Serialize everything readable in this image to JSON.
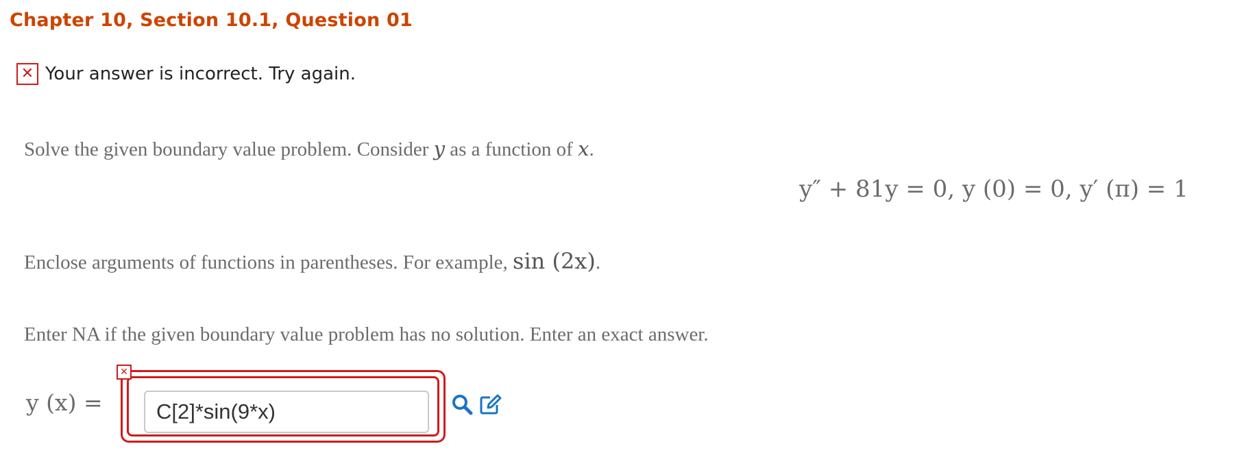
{
  "header": {
    "title": "Chapter 10, Section 10.1, Question 01"
  },
  "feedback": {
    "icon": "x-icon",
    "message": "Your answer is incorrect.  Try again."
  },
  "question": {
    "intro_text": "Solve the given boundary value problem. Consider ",
    "intro_var_y": "y",
    "intro_mid": " as a function of ",
    "intro_var_x": "x",
    "intro_end": ".",
    "equation": {
      "lhs": "y″ + 81y = 0, ",
      "bc1": "y (0) = 0, ",
      "bc2": "y′ (π) = 1"
    },
    "hint_text": "Enclose arguments of functions in parentheses. For example, ",
    "hint_example": "sin (2x)",
    "hint_end": ".",
    "instruction": "Enter NA if the given boundary value problem has no solution. Enter an exact answer."
  },
  "answer": {
    "label": "y (x) =",
    "value": "C[2]*sin(9*x)",
    "status_icon": "x-icon",
    "preview_icon": "search-icon",
    "editor_icon": "edit-icon"
  },
  "colors": {
    "title": "#cc4400",
    "error": "#d11a1a",
    "icon_blue": "#1a73c8"
  }
}
